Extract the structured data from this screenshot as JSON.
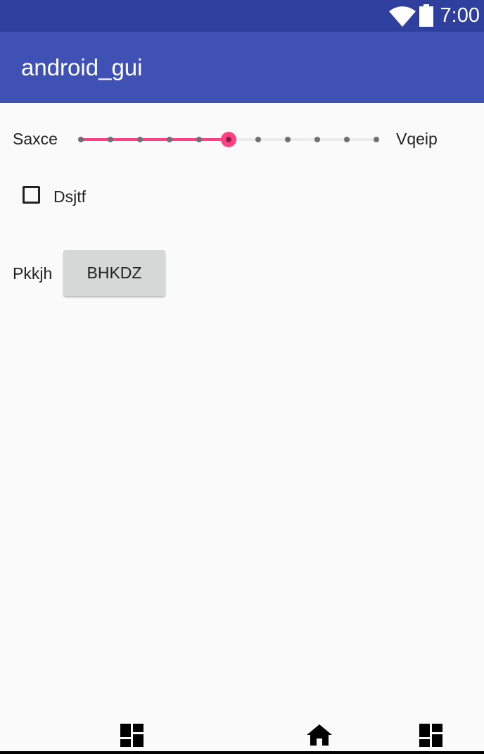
{
  "status_bar": {
    "time": "7:00"
  },
  "app_bar": {
    "title": "android_gui"
  },
  "slider": {
    "min_label": "Saxce",
    "max_label": "Vqeip",
    "steps": 10,
    "value": 5,
    "accent": "#ff4081"
  },
  "checkbox": {
    "label": "Dsjtf",
    "checked": false
  },
  "button_row": {
    "label": "Pkkjh",
    "button_label": "BHKDZ"
  },
  "colors": {
    "status_bar": "#2f3f9e",
    "app_bar": "#3f51b5",
    "background": "#fafafa"
  }
}
